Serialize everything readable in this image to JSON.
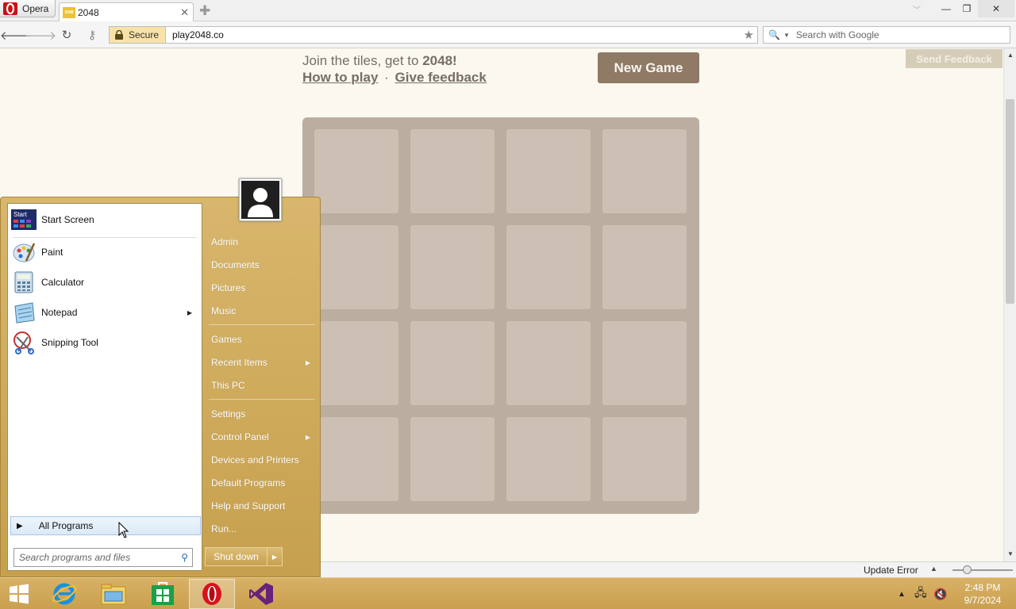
{
  "browser": {
    "menu_label": "Opera",
    "tab_title": "2048",
    "tab_favicon_text": "2048",
    "secure_label": "Secure",
    "url": "play2048.co",
    "search_placeholder": "Search with Google"
  },
  "page": {
    "intro_text": "Join the tiles, get to ",
    "intro_bold": "2048!",
    "how_to_play": "How to play",
    "separator": "·",
    "give_feedback": "Give feedback",
    "new_game_label": "New Game",
    "send_feedback_label": "Send Feedback",
    "grid_size": 4,
    "tiles": []
  },
  "start_menu": {
    "pinned": [
      {
        "label": "Start Screen",
        "icon": "start-screen-icon"
      },
      {
        "label": "Paint",
        "icon": "paint-icon"
      },
      {
        "label": "Calculator",
        "icon": "calculator-icon"
      },
      {
        "label": "Notepad",
        "icon": "notepad-icon",
        "has_submenu": true
      },
      {
        "label": "Snipping Tool",
        "icon": "snipping-tool-icon"
      }
    ],
    "start_screen_badge": "Start",
    "all_programs": "All Programs",
    "search_placeholder": "Search programs and files",
    "right_items": [
      {
        "label": "Admin"
      },
      {
        "label": "Documents"
      },
      {
        "label": "Pictures"
      },
      {
        "label": "Music"
      },
      {
        "label": "Games"
      },
      {
        "label": "Recent Items",
        "has_submenu": true
      },
      {
        "label": "This PC"
      },
      {
        "label": "Settings"
      },
      {
        "label": "Control Panel",
        "has_submenu": true
      },
      {
        "label": "Devices and Printers"
      },
      {
        "label": "Default Programs"
      },
      {
        "label": "Help and Support"
      },
      {
        "label": "Run..."
      }
    ],
    "shutdown_label": "Shut down"
  },
  "status_bar": {
    "update_error": "Update Error"
  },
  "taskbar": {
    "apps": [
      {
        "name": "windows-start-icon"
      },
      {
        "name": "internet-explorer-icon"
      },
      {
        "name": "file-explorer-icon"
      },
      {
        "name": "store-icon"
      },
      {
        "name": "opera-icon",
        "active": true
      },
      {
        "name": "visual-studio-icon"
      }
    ],
    "time": "2:48 PM",
    "date": "9/7/2024"
  },
  "colors": {
    "board": "#bbada0",
    "page_bg": "#faf8ef",
    "button": "#8f7a66",
    "start_menu": "#d2ae62"
  }
}
